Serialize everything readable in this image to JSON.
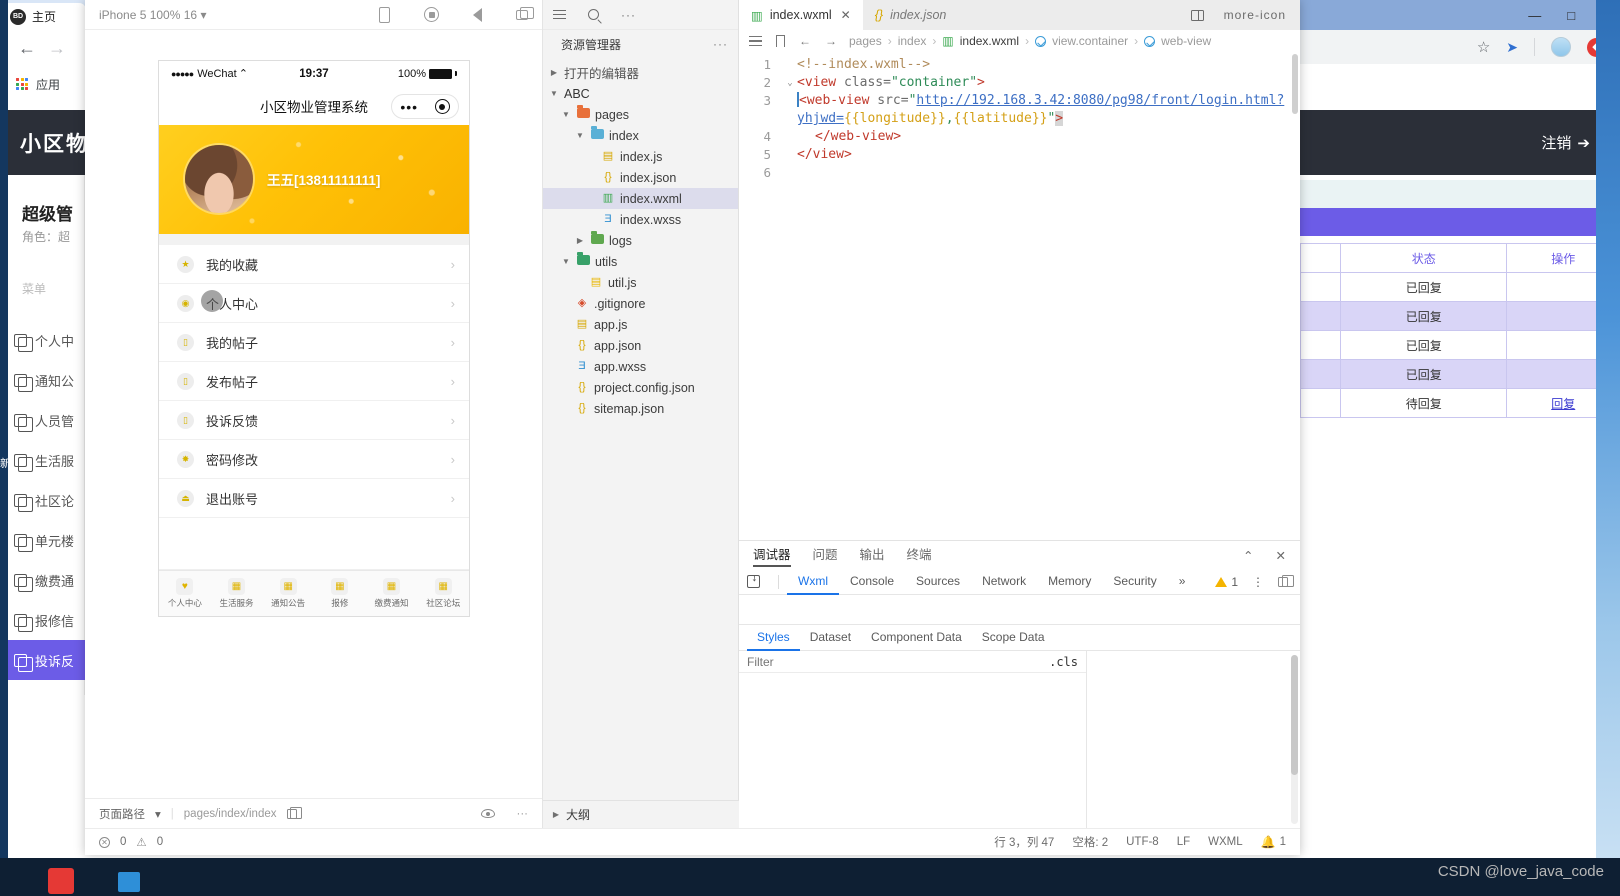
{
  "browser": {
    "tab_label": "主页",
    "logo_text": "BD",
    "back_icon": "arrow-left-icon",
    "forward_icon": "arrow-right-icon",
    "bookmark_label": "应用",
    "star_icon": "star-icon",
    "minimize": "—",
    "maximize": "□",
    "close": "✕"
  },
  "site": {
    "title": "小区物",
    "logout_label": "注销",
    "admin_name": "超级管",
    "admin_role": "角色：超",
    "menu_caption": "菜单",
    "menu_items": [
      {
        "label": "个人中"
      },
      {
        "label": "通知公"
      },
      {
        "label": "人员管"
      },
      {
        "label": "生活服"
      },
      {
        "label": "社区论"
      },
      {
        "label": "单元楼"
      },
      {
        "label": "缴费通"
      },
      {
        "label": "报修信"
      },
      {
        "label": "投诉反"
      }
    ],
    "active_menu_index": 8,
    "edge_note": "新",
    "table": {
      "headers": [
        "状态",
        "操作"
      ],
      "rows": [
        {
          "status": "已回复",
          "action": ""
        },
        {
          "status": "已回复",
          "action": ""
        },
        {
          "status": "已回复",
          "action": ""
        },
        {
          "status": "已回复",
          "action": ""
        },
        {
          "status": "待回复",
          "action": "回复"
        }
      ]
    }
  },
  "simulator": {
    "device_label": "iPhone 5 100% 16",
    "device_caret": "▾",
    "phone": {
      "carrier": "WeChat",
      "carrier_dots": "●●●●●",
      "wifi": "⛃",
      "time": "19:37",
      "battery_pct": "100%",
      "nav_title": "小区物业管理系统",
      "capsule_dots": "•••",
      "user_name": "王五[13811111111]",
      "menu": [
        {
          "label": "我的收藏",
          "icon": "star-icon"
        },
        {
          "label": "个人中心",
          "icon": "person-pin-icon"
        },
        {
          "label": "我的帖子",
          "icon": "post-icon"
        },
        {
          "label": "发布帖子",
          "icon": "post-icon"
        },
        {
          "label": "投诉反馈",
          "icon": "post-icon"
        },
        {
          "label": "密码修改",
          "icon": "lock-icon"
        },
        {
          "label": "退出账号",
          "icon": "exit-icon"
        }
      ],
      "chevron": "›",
      "tabbar": [
        {
          "label": "个人中心",
          "icon": "heart-icon"
        },
        {
          "label": "生活服务",
          "icon": "grid-icon"
        },
        {
          "label": "通知公告",
          "icon": "grid-icon"
        },
        {
          "label": "报修",
          "icon": "grid-icon"
        },
        {
          "label": "缴费通知",
          "icon": "grid-icon"
        },
        {
          "label": "社区论坛",
          "icon": "grid-icon"
        }
      ]
    },
    "footer": {
      "page_path_label": "页面路径",
      "caret": "▾",
      "path_value": "pages/index/index",
      "copy_icon": "copy-icon",
      "eye_icon": "eye-icon",
      "more_icon": "more-icon"
    }
  },
  "explorer": {
    "title": "资源管理器",
    "more": "···",
    "open_editors": "打开的编辑器",
    "project_name": "ABC",
    "outline_label": "大纲",
    "tree": [
      {
        "name": "pages",
        "type": "folder",
        "depth": 1,
        "expanded": true,
        "color": "#e8703a"
      },
      {
        "name": "index",
        "type": "folder",
        "depth": 2,
        "expanded": true,
        "color": "#5ab0d6"
      },
      {
        "name": "index.js",
        "type": "js",
        "depth": 3
      },
      {
        "name": "index.json",
        "type": "json",
        "depth": 3
      },
      {
        "name": "index.wxml",
        "type": "wxml",
        "depth": 3,
        "selected": true
      },
      {
        "name": "index.wxss",
        "type": "wxss",
        "depth": 3
      },
      {
        "name": "logs",
        "type": "folder",
        "depth": 2,
        "expanded": false,
        "color": "#5fa84f"
      },
      {
        "name": "utils",
        "type": "folder",
        "depth": 1,
        "expanded": true,
        "color": "#38a169"
      },
      {
        "name": "util.js",
        "type": "js",
        "depth": 2
      },
      {
        "name": ".gitignore",
        "type": "git",
        "depth": 1
      },
      {
        "name": "app.js",
        "type": "js",
        "depth": 1
      },
      {
        "name": "app.json",
        "type": "json",
        "depth": 1
      },
      {
        "name": "app.wxss",
        "type": "wxss",
        "depth": 1
      },
      {
        "name": "project.config.json",
        "type": "json",
        "depth": 1
      },
      {
        "name": "sitemap.json",
        "type": "json",
        "depth": 1
      }
    ]
  },
  "editor": {
    "tabs": [
      {
        "label": "index.wxml",
        "active": true,
        "closable": true,
        "icon": "wxml-icon"
      },
      {
        "label": "index.json",
        "active": false,
        "closable": false,
        "icon": "json-icon"
      }
    ],
    "close_glyph": "✕",
    "split_icon": "split-editor-icon",
    "more_icon": "more-icon",
    "breadcrumb": [
      "pages",
      "index",
      "index.wxml",
      "view.container",
      "web-view"
    ],
    "breadcrumb_sep": "›",
    "code_lines": [
      {
        "n": "1",
        "fold": ""
      },
      {
        "n": "2",
        "fold": "⌄"
      },
      {
        "n": "3",
        "fold": ""
      },
      {
        "n": "4",
        "fold": ""
      },
      {
        "n": "5",
        "fold": ""
      },
      {
        "n": "6",
        "fold": ""
      }
    ],
    "code": {
      "l1": "<!--index.wxml-->",
      "l2_tag": "<view",
      "l2_attr": " class=",
      "l2_val": "\"container\"",
      "l2_close": ">",
      "l3_tag": "<web-view",
      "l3_attr": " src=",
      "l3_q1": "\"",
      "l3_url": "http://192.168.3.42:8080/pg98/front/login.",
      "l3_url2": "html?yhjwd=",
      "l3_b1": "{{longitude}}",
      "l3_comma": ",",
      "l3_b2": "{{latitude}}",
      "l3_q2": "\"",
      "l3_close": ">",
      "l4": "</web-view>",
      "l5": "</view>"
    }
  },
  "debugger": {
    "panel_tabs": [
      {
        "label": "调试器",
        "active": true
      },
      {
        "label": "问题",
        "active": false
      },
      {
        "label": "输出",
        "active": false
      },
      {
        "label": "终端",
        "active": false
      }
    ],
    "collapse_icon": "chevron-up-icon",
    "close_icon": "close-icon",
    "devtools_tabs": [
      {
        "label": "Wxml",
        "active": true
      },
      {
        "label": "Console",
        "active": false
      },
      {
        "label": "Sources",
        "active": false
      },
      {
        "label": "Network",
        "active": false
      },
      {
        "label": "Memory",
        "active": false
      },
      {
        "label": "Security",
        "active": false
      }
    ],
    "overflow": "»",
    "warning_count": "1",
    "kebab": "⋮",
    "dock_icon": "dock-icon",
    "inspect_icon": "inspect-element-icon",
    "styles_tabs": [
      {
        "label": "Styles",
        "active": true
      },
      {
        "label": "Dataset",
        "active": false
      },
      {
        "label": "Component Data",
        "active": false
      },
      {
        "label": "Scope Data",
        "active": false
      }
    ],
    "filter_placeholder": "Filter",
    "cls_label": ".cls"
  },
  "status_bar": {
    "error_icon": "error-icon",
    "error_count": "0",
    "warn_icon": "warning-icon",
    "warn_count": "0",
    "cursor": "行 3，列 47",
    "spaces": "空格: 2",
    "encoding": "UTF-8",
    "eol": "LF",
    "language": "WXML",
    "bell_icon": "bell-icon",
    "bell_count": "1"
  },
  "watermark": "CSDN @love_java_code"
}
